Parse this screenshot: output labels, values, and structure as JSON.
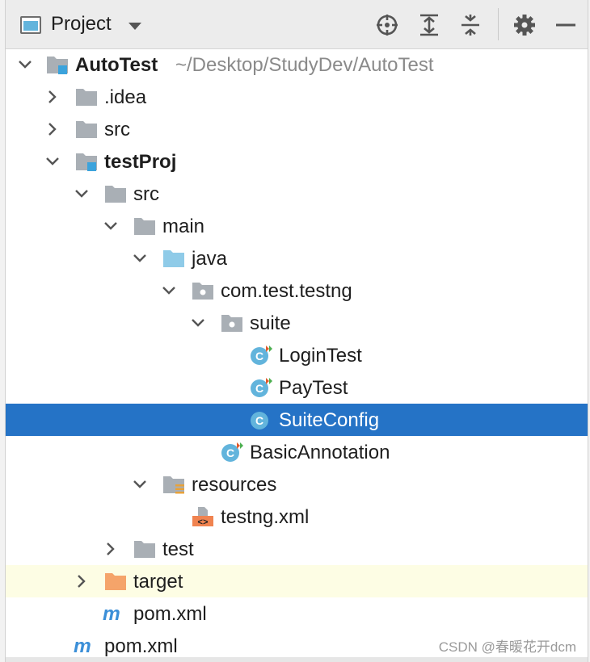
{
  "toolbar": {
    "title": "Project",
    "icons": [
      "select-opened-file-icon",
      "expand-all-icon",
      "collapse-all-icon",
      "gear-icon",
      "hide-icon"
    ]
  },
  "tree": {
    "root_label": "AutoTest",
    "root_path": "~/Desktop/StudyDev/AutoTest",
    "idea": ".idea",
    "src_top": "src",
    "testproj": "testProj",
    "src": "src",
    "main": "main",
    "java": "java",
    "package": "com.test.testng",
    "suite": "suite",
    "login_test": "LoginTest",
    "pay_test": "PayTest",
    "suite_config": "SuiteConfig",
    "basic_annotation": "BasicAnnotation",
    "resources": "resources",
    "testng_xml": "testng.xml",
    "test": "test",
    "target": "target",
    "pom_inner": "pom.xml",
    "pom_outer": "pom.xml"
  },
  "watermark": "CSDN @春暖花开dcm",
  "colors": {
    "selection": "#2573c6",
    "excluded_background": "#fdfde4",
    "folder_gray": "#a9afb5",
    "source_folder_blue": "#8fcbe8",
    "excluded_folder_orange": "#f5a46a",
    "class_icon": "#62b4dc",
    "maven_blue": "#3b8fd8"
  }
}
